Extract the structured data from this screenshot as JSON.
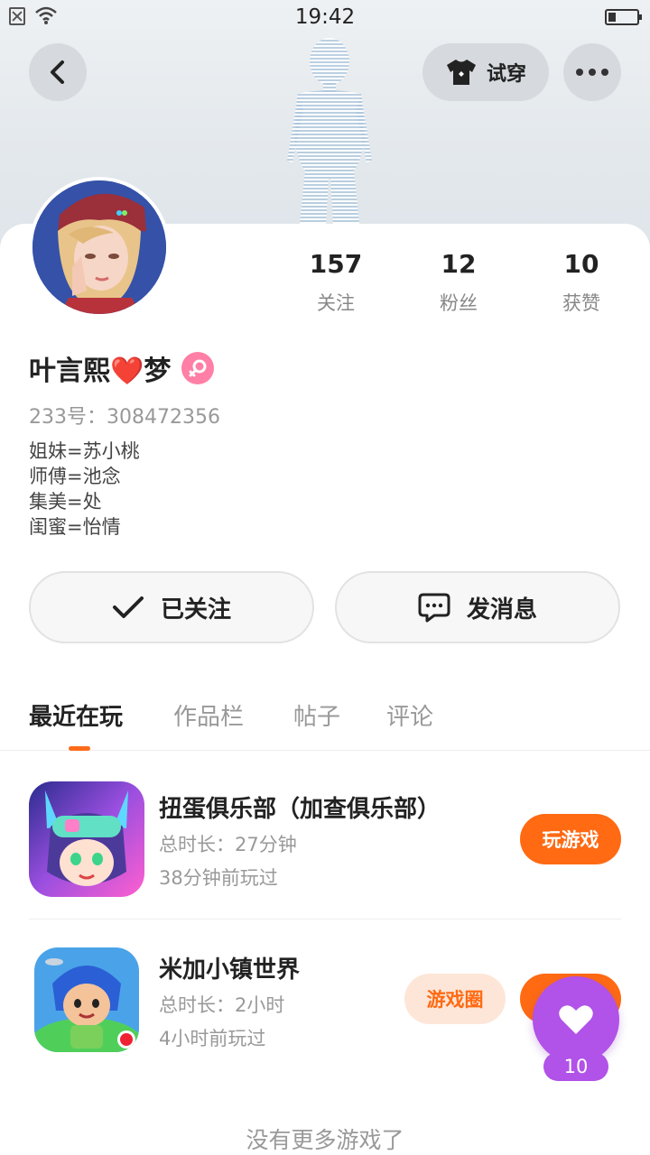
{
  "status_bar": {
    "time": "19:42"
  },
  "header": {
    "try_on_label": "试穿"
  },
  "profile": {
    "username": "叶言熙❤️梦",
    "uid": "233号：308472356",
    "bio": [
      "姐妹=苏小桃",
      "师傅=池念",
      "集美=处",
      "闺蜜=怡情"
    ],
    "stats": [
      {
        "value": "157",
        "label": "关注"
      },
      {
        "value": "12",
        "label": "粉丝"
      },
      {
        "value": "10",
        "label": "获赞"
      }
    ]
  },
  "actions": {
    "follow_label": "已关注",
    "message_label": "发消息"
  },
  "tabs": [
    {
      "label": "最近在玩",
      "active": true
    },
    {
      "label": "作品栏",
      "active": false
    },
    {
      "label": "帖子",
      "active": false
    },
    {
      "label": "评论",
      "active": false
    }
  ],
  "games": [
    {
      "title": "扭蛋俱乐部（加查俱乐部）",
      "duration": "总时长：27分钟",
      "last_played": "38分钟前玩过",
      "play_label": "玩游戏"
    },
    {
      "title": "米加小镇世界",
      "duration": "总时长：2小时",
      "last_played": "4小时前玩过",
      "circle_label": "游戏圈",
      "play_label": "玩游戏"
    }
  ],
  "like_fab": {
    "count": "10"
  },
  "footer": {
    "no_more": "没有更多游戏了"
  },
  "colors": {
    "accent": "#ff6a13",
    "like": "#b152e8",
    "gender": "#ff7fa6"
  }
}
